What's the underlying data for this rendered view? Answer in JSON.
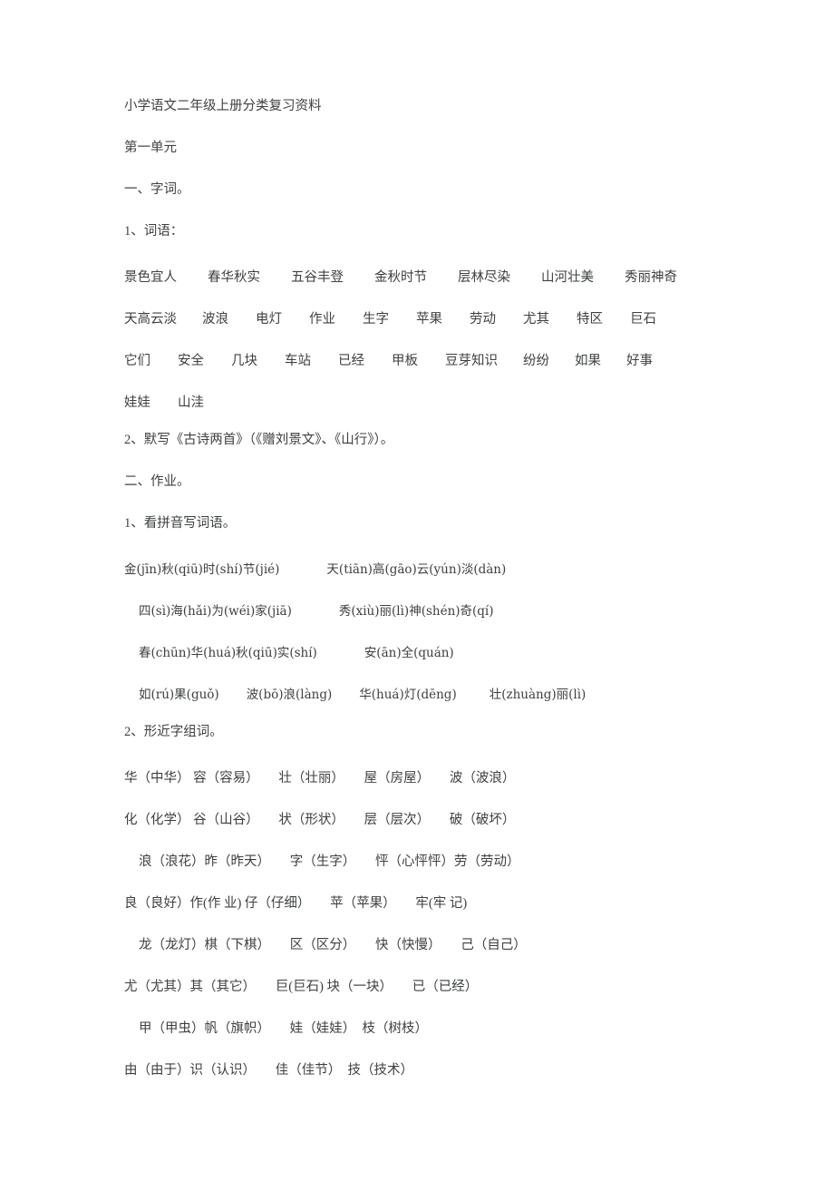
{
  "document": {
    "title": "小学语文二年级上册分类复习资料",
    "unit": "第一单元",
    "text_color": "#3c413c",
    "background_color": "#ffffff"
  },
  "section_one": {
    "heading": "一、字词。",
    "sub1_label": "1、词语：",
    "vocab_rows": [
      [
        "景色宜人",
        "春华秋实",
        "五谷丰登",
        "金秋时节",
        "层林尽染",
        "山河壮美",
        "秀丽神奇"
      ],
      [
        "天高云淡",
        "波浪",
        "电灯",
        "作业",
        "生字",
        "苹果",
        "劳动",
        "尤其",
        "特区",
        "巨石"
      ],
      [
        "它们",
        "安全",
        "几块",
        "车站",
        "已经",
        "甲板",
        "豆芽知识",
        "纷纷",
        "如果",
        "好事"
      ],
      [
        "娃娃",
        "山洼"
      ]
    ],
    "sub2_label": "2、默写《古诗两首》（《赠刘景文》、《山行》）。"
  },
  "section_two": {
    "heading": "二、作业。",
    "sub1_label": "1、看拼音写词语。",
    "pinyin_rows": [
      {
        "indent": 0,
        "items": [
          "金(jīn)秋(qiū)时(shí)节(jié)",
          "天(tiān)高(gāo)云(yún)淡(dàn)"
        ]
      },
      {
        "indent": 1,
        "items": [
          "四(sì)海(hǎi)为(wéi)家(jiā)",
          "秀(xiù)丽(lì)神(shén)奇(qí)"
        ]
      },
      {
        "indent": 1,
        "items": [
          "春(chūn)华(huá)秋(qiū)实(shí)",
          "安(ān)全(quán)"
        ]
      },
      {
        "indent": 1,
        "items": [
          "如(rú)果(guǒ)",
          "波(bō)浪(làng)",
          "华(huá)灯(dēng)",
          "壮(zhuàng)丽(lì)"
        ]
      }
    ],
    "sub2_label": "2、形近字组词。",
    "xingjinzi_rows": [
      {
        "indent": 0,
        "text": "华（中华） 容（容易）　　壮（壮丽）　　屋（房屋）　　波（波浪）"
      },
      {
        "indent": 0,
        "text": "化（化学） 谷（山谷）　　状（形状）　　层（层次）　　破（破坏）"
      },
      {
        "indent": 1,
        "text": "浪（浪花）昨（昨天）　　字（生字）　　怦（心怦怦）劳（劳动）"
      },
      {
        "indent": 0,
        "text": "良（良好）作(作 业) 仔（仔细）　　苹（苹果）　　牢(牢 记)"
      },
      {
        "indent": 1,
        "text": "龙（龙灯）棋（下棋）　　区（区分）　　快（快慢）　　己（自己）"
      },
      {
        "indent": 0,
        "text": "尤（尤其）其（其它）　　巨(巨石) 块（一块）　　已（已经）"
      },
      {
        "indent": 1,
        "text": "甲（甲虫）帆（旗帜）　　娃（娃娃）　枝（树枝）"
      },
      {
        "indent": 0,
        "text": "由（由于）识（认识）　　佳（佳节）　技（技术）"
      }
    ]
  }
}
